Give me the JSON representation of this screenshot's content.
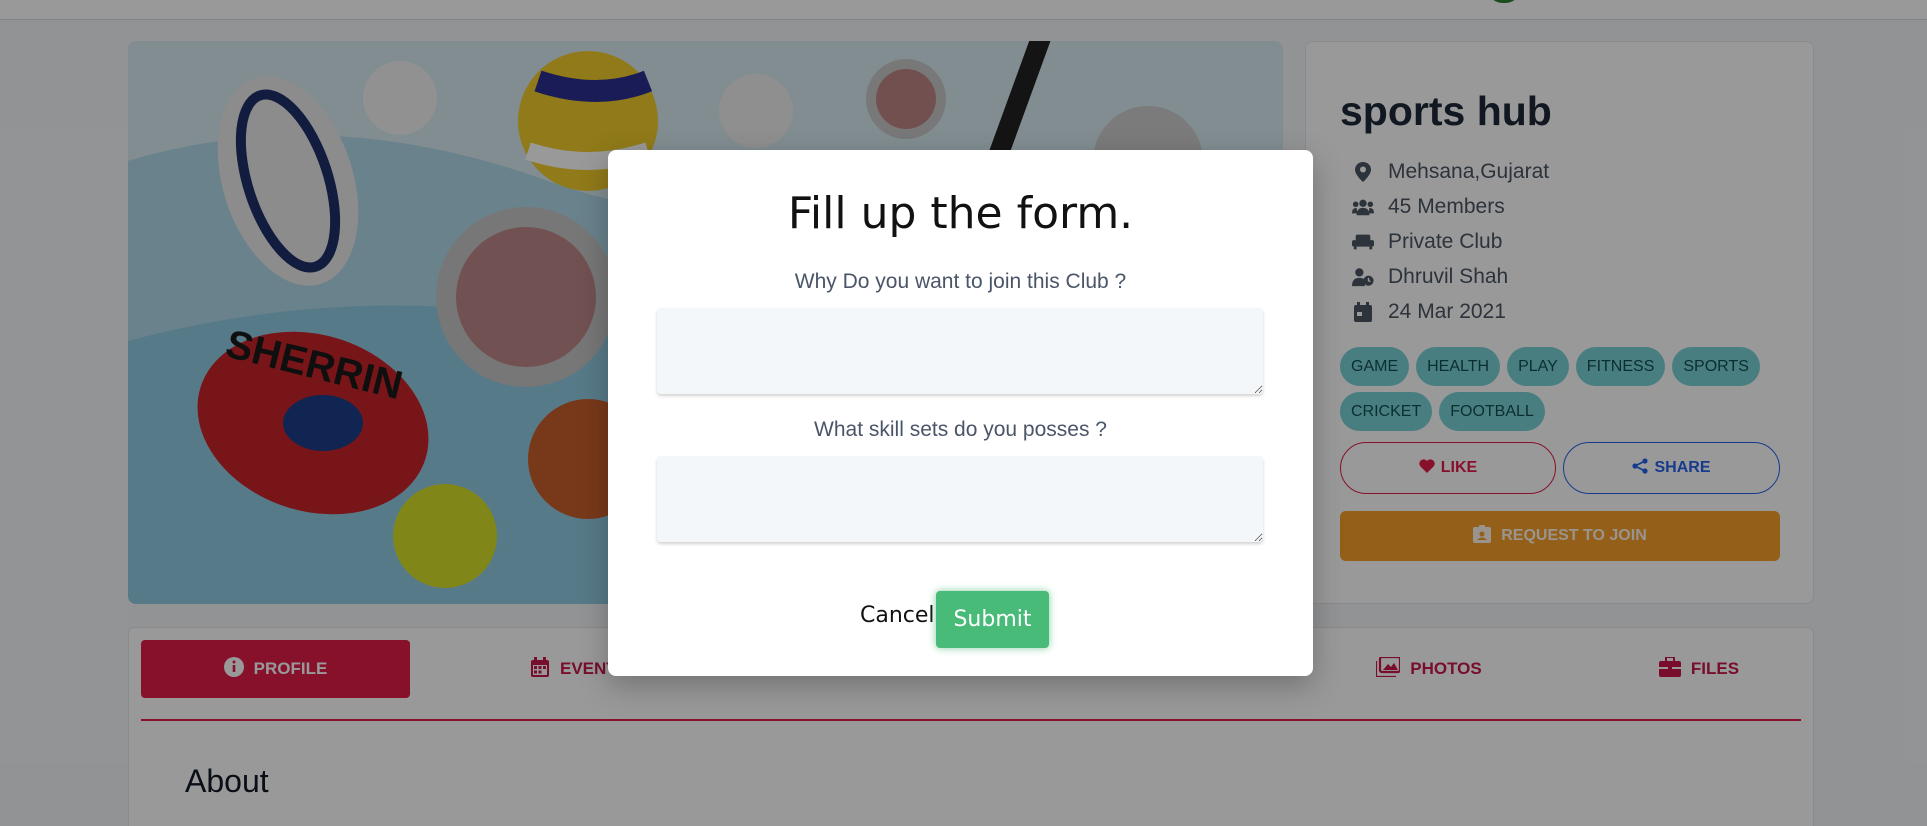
{
  "club": {
    "title": "sports hub",
    "location": "Mehsana,Gujarat",
    "members": "45 Members",
    "type": "Private Club",
    "owner": "Dhruvil Shah",
    "date": "24 Mar 2021",
    "tags": [
      "GAME",
      "HEALTH",
      "PLAY",
      "FITNESS",
      "SPORTS",
      "CRICKET",
      "FOOTBALL"
    ],
    "like_label": "LIKE",
    "share_label": "SHARE",
    "join_label": "REQUEST TO JOIN"
  },
  "tabs": [
    {
      "label": "PROFILE",
      "icon": "info-icon",
      "active": true
    },
    {
      "label": "EVENTS",
      "icon": "calendar-icon",
      "active": false
    },
    {
      "label": "PHOTOS",
      "icon": "images-icon",
      "active": false
    },
    {
      "label": "FILES",
      "icon": "briefcase-icon",
      "active": false
    }
  ],
  "about_heading": "About",
  "modal": {
    "title": "Fill up the form.",
    "question1": "Why Do you want to join this Club ?",
    "answer1": "",
    "question2": "What skill sets do you posses ?",
    "answer2": "",
    "cancel_label": "Cancel",
    "submit_label": "Submit"
  },
  "colors": {
    "primary": "#e11d48",
    "join": "#f59e2a",
    "submit": "#48bb78",
    "share": "#2563eb",
    "tag": "#7ad3d8"
  }
}
